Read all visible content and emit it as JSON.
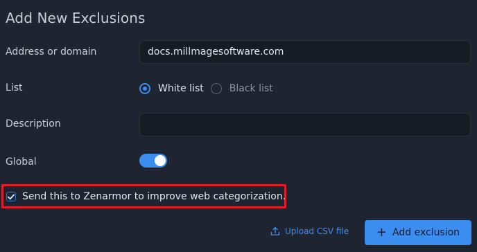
{
  "dialog": {
    "title": "Add New Exclusions"
  },
  "form": {
    "address": {
      "label": "Address or domain",
      "value": "docs.millmagesoftware.com"
    },
    "list": {
      "label": "List",
      "options": [
        "White list",
        "Black list"
      ],
      "selected": "White list"
    },
    "description": {
      "label": "Description",
      "value": ""
    },
    "global": {
      "label": "Global",
      "enabled": true
    },
    "send_to_zenarmor": {
      "label": "Send this to Zenarmor to improve web categorization.",
      "checked": true
    }
  },
  "actions": {
    "upload_csv": "Upload CSV file",
    "add_exclusion": "Add exclusion"
  },
  "colors": {
    "background": "#1e2530",
    "input_background": "#171c24",
    "accent": "#3b8df0",
    "highlight": "#e01e25"
  },
  "icons": {
    "upload": "upload-icon",
    "plus": "plus-icon",
    "check": "check-icon"
  }
}
